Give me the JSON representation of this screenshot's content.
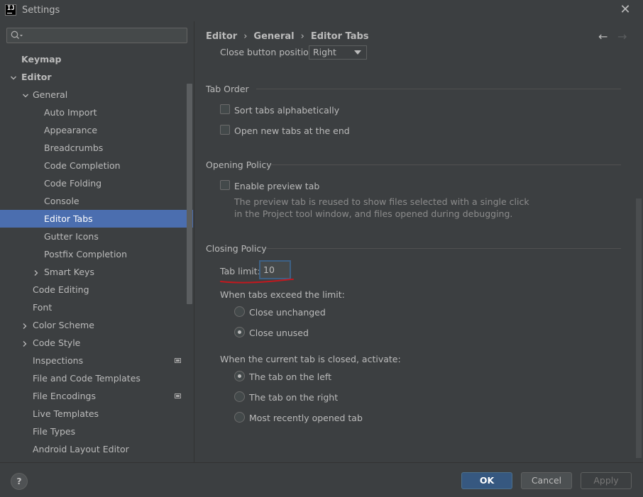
{
  "window": {
    "title": "Settings",
    "app_icon_letters": "IJ"
  },
  "search": {
    "placeholder": ""
  },
  "sidebar": {
    "items": [
      {
        "label": "Keymap"
      },
      {
        "label": "Editor"
      },
      {
        "label": "General"
      },
      {
        "label": "Auto Import"
      },
      {
        "label": "Appearance"
      },
      {
        "label": "Breadcrumbs"
      },
      {
        "label": "Code Completion"
      },
      {
        "label": "Code Folding"
      },
      {
        "label": "Console"
      },
      {
        "label": "Editor Tabs"
      },
      {
        "label": "Gutter Icons"
      },
      {
        "label": "Postfix Completion"
      },
      {
        "label": "Smart Keys"
      },
      {
        "label": "Code Editing"
      },
      {
        "label": "Font"
      },
      {
        "label": "Color Scheme"
      },
      {
        "label": "Code Style"
      },
      {
        "label": "Inspections"
      },
      {
        "label": "File and Code Templates"
      },
      {
        "label": "File Encodings"
      },
      {
        "label": "Live Templates"
      },
      {
        "label": "File Types"
      },
      {
        "label": "Android Layout Editor"
      }
    ]
  },
  "breadcrumb": {
    "items": [
      "Editor",
      "General",
      "Editor Tabs"
    ],
    "separator": "›"
  },
  "nav": {
    "back": "←",
    "forward": "→"
  },
  "close_button": {
    "label": "Close button position:",
    "value": "Right"
  },
  "tab_order": {
    "title": "Tab Order",
    "sort_alphabetically": "Sort tabs alphabetically",
    "open_at_end": "Open new tabs at the end"
  },
  "opening_policy": {
    "title": "Opening Policy",
    "enable_preview": "Enable preview tab",
    "desc_line1": "The preview tab is reused to show files selected with a single click",
    "desc_line2": "in the Project tool window, and files opened during debugging."
  },
  "closing_policy": {
    "title": "Closing Policy",
    "tab_limit_label": "Tab limit:",
    "tab_limit_value": "10",
    "exceed_label": "When tabs exceed the limit:",
    "close_unchanged": "Close unchanged",
    "close_unused": "Close unused",
    "activate_label": "When the current tab is closed, activate:",
    "tab_left": "The tab on the left",
    "tab_right": "The tab on the right",
    "most_recent": "Most recently opened tab"
  },
  "footer": {
    "help": "?",
    "ok": "OK",
    "cancel": "Cancel",
    "apply": "Apply"
  },
  "colors": {
    "selection": "#4b6eaf",
    "annotation": "#c2181e",
    "primary_button": "#365880"
  }
}
